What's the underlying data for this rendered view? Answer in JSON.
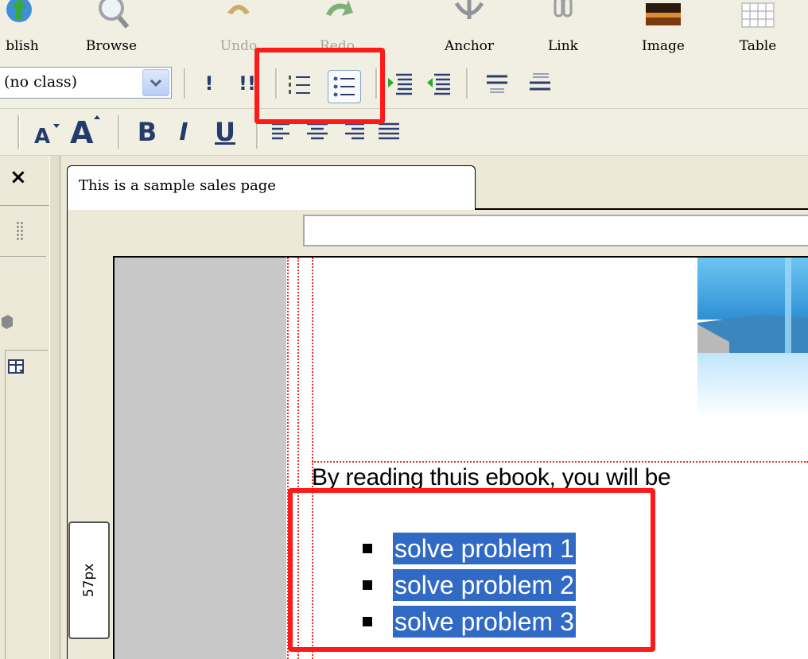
{
  "toolbar": {
    "buttons": [
      {
        "label": "blish",
        "icon": "publish-icon",
        "disabled": false
      },
      {
        "label": "Browse",
        "icon": "browse-icon",
        "disabled": false
      },
      {
        "label": "Undo",
        "icon": "undo-icon",
        "disabled": true
      },
      {
        "label": "Redo",
        "icon": "redo-icon",
        "disabled": true
      },
      {
        "label": "Anchor",
        "icon": "anchor-icon",
        "disabled": false
      },
      {
        "label": "Link",
        "icon": "link-icon",
        "disabled": false
      },
      {
        "label": "Image",
        "icon": "image-icon",
        "disabled": false
      },
      {
        "label": "Table",
        "icon": "table-icon",
        "disabled": false
      }
    ]
  },
  "format_bar": {
    "class_select_value": "(no class)",
    "important_single": "!",
    "important_double": "!!"
  },
  "style_bar": {
    "bold": "B",
    "italic": "I",
    "underline": "U"
  },
  "left_panel": {
    "close_glyph": "×"
  },
  "document": {
    "tab_title": "This is a sample sales page",
    "body_text": "By reading thuis ebook, you will be",
    "list_items": [
      "solve problem 1",
      "solve problem 2",
      "solve problem 3"
    ],
    "ruler_label": "57px"
  },
  "colors": {
    "highlight": "#ff1a1a",
    "selection": "#316ac5",
    "guide_dots": "#e03030"
  }
}
